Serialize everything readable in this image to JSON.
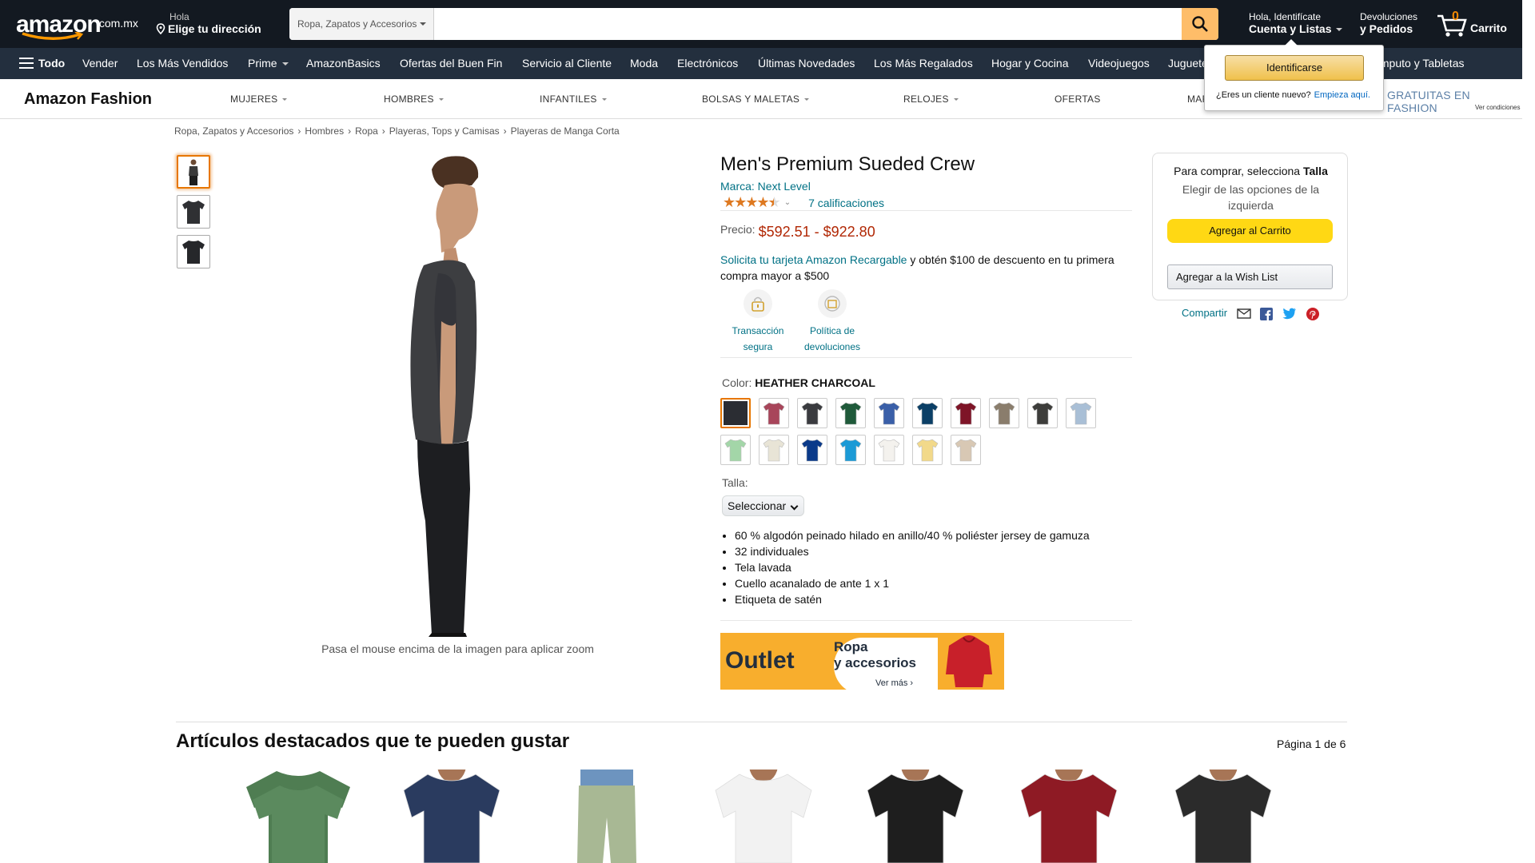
{
  "header": {
    "logo_text": "amazon",
    "logo_tld": ".com.mx",
    "deliver_line1": "Hola",
    "deliver_line2": "Elige tu dirección",
    "search_category": "Ropa, Zapatos y Accesorios",
    "search_value": "",
    "account_line1": "Hola, Identifícate",
    "account_line2": "Cuenta y Listas",
    "returns_line1": "Devoluciones",
    "returns_line2": "y Pedidos",
    "cart_count": "0",
    "cart_label": "Carrito"
  },
  "nav": {
    "todo": "Todo",
    "items": [
      "Vender",
      "Los Más Vendidos",
      "Prime",
      "AmazonBasics",
      "Ofertas del Buen Fin",
      "Servicio al Cliente",
      "Moda",
      "Electrónicos",
      "Últimas Novedades",
      "Los Más Regalados",
      "Hogar y Cocina",
      "Videojuegos",
      "Juguetes",
      "Cómputo y Tabletas"
    ]
  },
  "fashion": {
    "logo": "Amazon Fashion",
    "categories": [
      "MUJERES",
      "HOMBRES",
      "INFANTILES",
      "BOLSAS Y MALETAS",
      "RELOJES",
      "OFERTAS",
      "MAR"
    ],
    "promo": "GRATUITAS EN FASHION",
    "promo_sub": "Ver condiciones"
  },
  "signin_popover": {
    "button": "Identificarse",
    "new_customer": "¿Eres un cliente nuevo?",
    "start_link": "Empieza aquí."
  },
  "breadcrumb": [
    "Ropa, Zapatos y Accesorios",
    "Hombres",
    "Ropa",
    "Playeras, Tops y Camisas",
    "Playeras de Manga Corta"
  ],
  "gallery": {
    "zoom_hint": "Pasa el mouse encima de la imagen para aplicar zoom"
  },
  "product": {
    "title": "Men's Premium Sueded Crew",
    "brand": "Marca: Next Level",
    "rating_count": "7 calificaciones",
    "rating_stars": 4.5,
    "price_label": "Precio:",
    "price": "$592.51 - $922.80",
    "promo_link": "Solicita tu tarjeta Amazon Recargable",
    "promo_text": " y obtén $100 de descuento en tu primera compra mayor a $500",
    "badges": [
      "Transacción segura",
      "Política de devoluciones"
    ],
    "color_label": "Color:",
    "color_value": "HEATHER CHARCOAL",
    "swatches": [
      "#2b2d33",
      "#a8455a",
      "#3a3b3f",
      "#1f5a3a",
      "#3a5fa8",
      "#0b3f66",
      "#7e1427",
      "#8a7d6c",
      "#3d3d3b",
      "#a9bfd6",
      "#a3d6a8",
      "#e8e4d6",
      "#0a3a8a",
      "#1b9ad6",
      "#f4f2ee",
      "#f2d98a",
      "#d8c8b4"
    ],
    "size_label": "Talla:",
    "size_value": "Seleccionar",
    "bullets": [
      "60 % algodón peinado hilado en anillo/40 % poliéster jersey de gamuza",
      "32 individuales",
      "Tela lavada",
      "Cuello acanalado de ante 1 x 1",
      "Etiqueta de satén"
    ]
  },
  "outlet": {
    "big": "Outlet",
    "line1": "Ropa",
    "line2": "y accesorios",
    "more": "Ver más ›"
  },
  "buybox": {
    "line1_a": "Para comprar, selecciona ",
    "line1_b": "Talla",
    "line2": "Elegir de las opciones de la izquierda",
    "cart_button": "Agregar al Carrito",
    "wish_button": "Agregar a la Wish List",
    "share": "Compartir"
  },
  "recommendations": {
    "title": "Artículos destacados que te pueden gustar",
    "page": "Página 1 de 6",
    "product_colors": [
      "#5b8a5e",
      "#2a3b5f",
      "#a8b894",
      "#f2f2f2",
      "#1e1e1e",
      "#8e1a24",
      "#2b2b2b"
    ]
  }
}
